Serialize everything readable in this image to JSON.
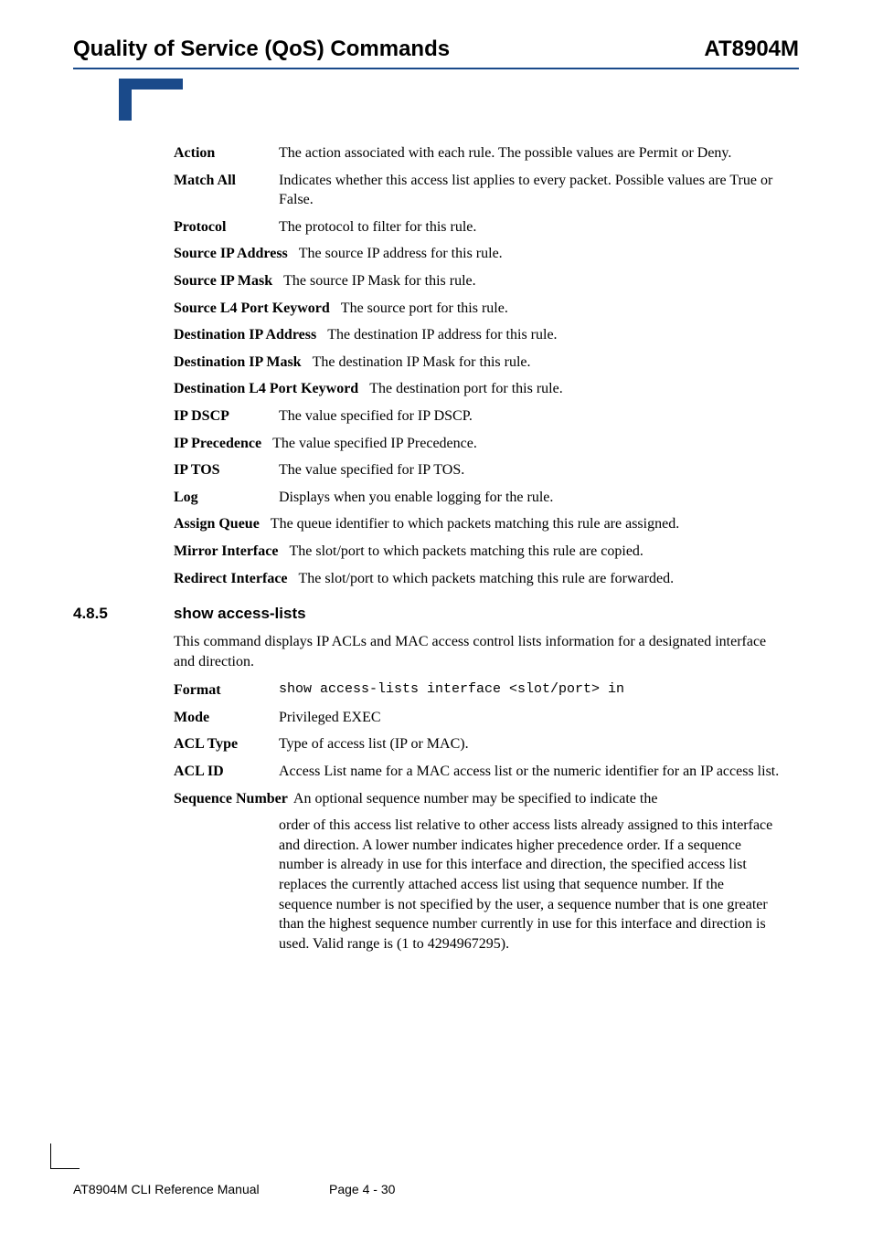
{
  "header": {
    "left": "Quality of Service (QoS) Commands",
    "right": "AT8904M"
  },
  "defs1": {
    "action_t": "Action",
    "action_d": "The action associated with each rule. The possible values are Permit or Deny.",
    "matchall_t": "Match All",
    "matchall_d": "Indicates whether this access list applies to every packet. Possible values are True or False.",
    "protocol_t": "Protocol",
    "protocol_d": "The protocol to filter for this rule.",
    "srcip_t": "Source IP Address",
    "srcip_d": "The source IP address for this rule.",
    "srcmask_t": "Source IP Mask",
    "srcmask_d": "The source IP Mask for this rule.",
    "srcport_t": "Source L4 Port Keyword",
    "srcport_d": "The source port for this rule.",
    "dstip_t": "Destination IP Address",
    "dstip_d": "The destination IP address for this rule.",
    "dstmask_t": "Destination IP Mask",
    "dstmask_d": "The destination IP Mask for this rule.",
    "dstport_t": "Destination L4 Port Keyword",
    "dstport_d": "The destination port for this rule.",
    "dscp_t": "IP DSCP",
    "dscp_d": "The value specified for IP DSCP.",
    "prec_t": "IP Precedence",
    "prec_d": "The value specified IP Precedence.",
    "tos_t": "IP TOS",
    "tos_d": "The value specified for IP TOS.",
    "log_t": "Log",
    "log_d": "Displays when you enable logging for the rule.",
    "assignq_t": "Assign Queue",
    "assignq_d": "The queue identifier to which packets matching this rule are assigned.",
    "mirror_t": "Mirror Interface",
    "mirror_d": "The slot/port to which packets matching this rule are copied.",
    "redirect_t": "Redirect Interface",
    "redirect_d": "The slot/port to which packets matching this rule are forwarded."
  },
  "section": {
    "num": "4.8.5",
    "title": "show access-lists",
    "intro": "This command displays IP ACLs and MAC access control lists information for a designated interface and direction.",
    "format_t": "Format",
    "format_d": "show access-lists interface <slot/port> in",
    "mode_t": "Mode",
    "mode_d": "Privileged EXEC",
    "acltype_t": "ACL Type",
    "acltype_d": "Type of access list (IP or MAC).",
    "aclid_t": "ACL ID",
    "aclid_d": "Access List name for a MAC access list or the numeric identifier for an IP access list.",
    "seq_t": "Sequence Number",
    "seq_d_lead": "An optional sequence number may be specified to indicate the",
    "seq_d_rest": "order of this access list relative to other access lists already assigned to this interface and direction. A lower number indicates higher precedence order. If a sequence number is already in use for this interface and direction, the specified access list replaces the currently attached access list using that sequence number. If the sequence number is not specified by the user, a sequence number that is one greater than the highest sequence number currently in use for this interface and direction is used. Valid range is (1 to 4294967295)."
  },
  "footer": {
    "left": "AT8904M CLI Reference Manual",
    "center": "Page 4 - 30"
  }
}
